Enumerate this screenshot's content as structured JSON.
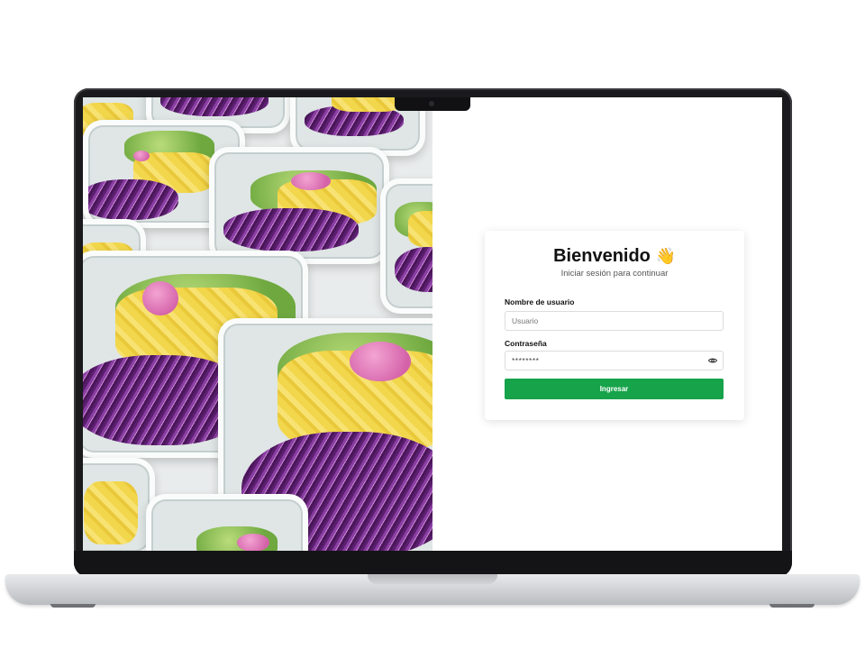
{
  "login": {
    "title": "Bienvenido",
    "title_emoji": "👋",
    "subtitle": "Iniciar sesión para continuar",
    "username_label": "Nombre de usuario",
    "username_placeholder": "Usuario",
    "username_value": "",
    "password_label": "Contraseña",
    "password_value": "********",
    "submit_label": "Ingresar"
  },
  "icons": {
    "password_toggle": "eye-icon",
    "title_emoji": "waving-hand-icon"
  },
  "colors": {
    "accent": "#16a34a",
    "card_bg": "#ffffff",
    "page_bg": "#ffffff"
  }
}
